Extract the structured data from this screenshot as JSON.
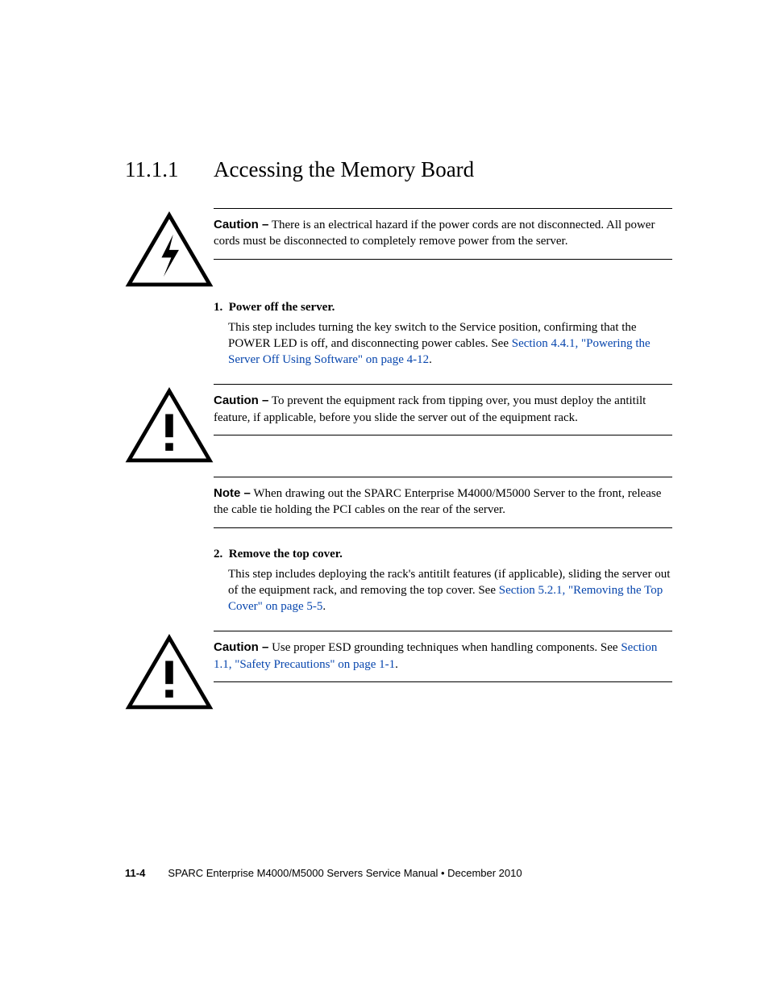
{
  "section": {
    "number": "11.1.1",
    "title": "Accessing the Memory Board"
  },
  "caution1": {
    "label": "Caution –",
    "text": " There is an electrical hazard if the power cords are not disconnected. All power cords must be disconnected to completely remove power from the server."
  },
  "step1": {
    "number": "1.",
    "heading": "Power off the server.",
    "text1": "This step includes turning the key switch to the Service position, confirming that the POWER LED is off, and disconnecting power cables. See ",
    "link": "Section 4.4.1, \"Powering the Server Off Using Software\" on page 4-12",
    "text2": "."
  },
  "caution2": {
    "label": "Caution –",
    "text": " To prevent the equipment rack from tipping over, you must deploy the antitilt feature, if applicable, before you slide the server out of the equipment rack."
  },
  "note1": {
    "label": "Note –",
    "text": " When drawing out the SPARC Enterprise M4000/M5000 Server to the front, release the cable tie holding the PCI cables on the rear of the server."
  },
  "step2": {
    "number": "2.",
    "heading": "Remove the top cover.",
    "text1": "This step includes deploying the rack's antitilt features (if applicable), sliding the server out of the equipment rack, and removing the top cover. See ",
    "link": "Section 5.2.1, \"Removing the Top Cover\" on page 5-5",
    "text2": "."
  },
  "caution3": {
    "label": "Caution –",
    "text1": " Use proper ESD grounding techniques when handling components. See ",
    "link": "Section 1.1, \"Safety Precautions\" on page 1-1",
    "text2": "."
  },
  "footer": {
    "page": "11-4",
    "text": "SPARC Enterprise M4000/M5000 Servers Service Manual  •  December 2010"
  }
}
